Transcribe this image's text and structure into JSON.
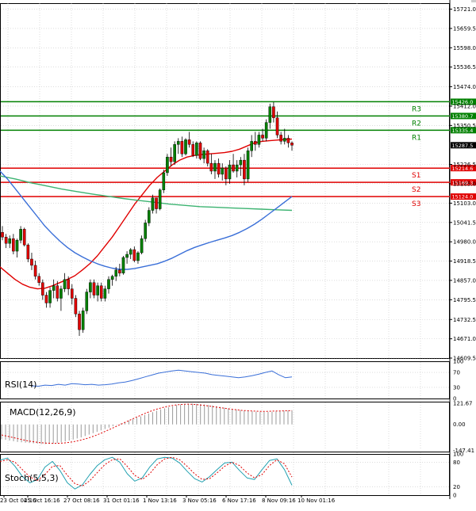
{
  "chart_data": [
    {
      "type": "candlestick",
      "panel": "price",
      "ylim": [
        14609.5,
        15740
      ],
      "y_ticks": [
        "15721.0",
        "15659.5",
        "15598.0",
        "15536.5",
        "15474.0",
        "15412.0",
        "15350.5",
        "15226.5",
        "15165.0",
        "15103.0",
        "15041.5",
        "14980.0",
        "14918.5",
        "14857.0",
        "14795.5",
        "14732.5",
        "14671.0",
        "14609.5"
      ],
      "x_ticks": [
        "23 Oct 04:16",
        "25 Oct 16:16",
        "27 Oct 08:16",
        "31 Oct 01:16",
        "1 Nov 13:16",
        "3 Nov 05:16",
        "6 Nov 17:16",
        "8 Nov 09:16",
        "10 Nov 01:16"
      ],
      "last_price": "15287.5",
      "levels": [
        {
          "name": "R3",
          "value": 15426.0,
          "label": "15426.0",
          "color": "#008000"
        },
        {
          "name": "R2",
          "value": 15380.7,
          "label": "15380.7",
          "color": "#008000"
        },
        {
          "name": "R1",
          "value": 15335.4,
          "label": "15335.4",
          "color": "#008000"
        },
        {
          "name": "S1",
          "value": 15214.6,
          "label": "15214.6",
          "color": "#e00000"
        },
        {
          "name": "S2",
          "value": 15169.3,
          "label": "15169.3",
          "color": "#e00000"
        },
        {
          "name": "S3",
          "value": 15124.0,
          "label": "15124.0",
          "color": "#e00000"
        }
      ],
      "candles": [
        [
          15010,
          15030,
          14985,
          14995
        ],
        [
          14995,
          15005,
          14960,
          14975
        ],
        [
          14975,
          15000,
          14960,
          14990
        ],
        [
          14990,
          15005,
          14940,
          14950
        ],
        [
          14950,
          14990,
          14930,
          14985
        ],
        [
          14985,
          15030,
          14975,
          15020
        ],
        [
          15020,
          15025,
          14965,
          14970
        ],
        [
          14970,
          14975,
          14915,
          14925
        ],
        [
          14925,
          14945,
          14890,
          14905
        ],
        [
          14905,
          14920,
          14860,
          14870
        ],
        [
          14870,
          14880,
          14840,
          14850
        ],
        [
          14850,
          14860,
          14795,
          14810
        ],
        [
          14810,
          14820,
          14770,
          14785
        ],
        [
          14785,
          14835,
          14770,
          14825
        ],
        [
          14825,
          14860,
          14800,
          14840
        ],
        [
          14840,
          14855,
          14790,
          14800
        ],
        [
          14800,
          14840,
          14760,
          14830
        ],
        [
          14830,
          14880,
          14820,
          14860
        ],
        [
          14860,
          14870,
          14810,
          14830
        ],
        [
          14830,
          14845,
          14780,
          14800
        ],
        [
          14800,
          14810,
          14740,
          14750
        ],
        [
          14750,
          14760,
          14680,
          14700
        ],
        [
          14700,
          14770,
          14690,
          14760
        ],
        [
          14760,
          14830,
          14750,
          14820
        ],
        [
          14820,
          14860,
          14800,
          14850
        ],
        [
          14850,
          14860,
          14800,
          14810
        ],
        [
          14810,
          14850,
          14790,
          14840
        ],
        [
          14840,
          14850,
          14790,
          14800
        ],
        [
          14800,
          14840,
          14790,
          14830
        ],
        [
          14830,
          14870,
          14815,
          14860
        ],
        [
          14860,
          14875,
          14840,
          14870
        ],
        [
          14870,
          14900,
          14855,
          14890
        ],
        [
          14890,
          14910,
          14870,
          14880
        ],
        [
          14880,
          14935,
          14875,
          14930
        ],
        [
          14930,
          14950,
          14910,
          14940
        ],
        [
          14940,
          14960,
          14925,
          14955
        ],
        [
          14955,
          14965,
          14915,
          14920
        ],
        [
          14920,
          14950,
          14910,
          14945
        ],
        [
          14945,
          15000,
          14940,
          14990
        ],
        [
          14990,
          15050,
          14980,
          15040
        ],
        [
          15040,
          15090,
          15030,
          15080
        ],
        [
          15080,
          15130,
          15070,
          15120
        ],
        [
          15120,
          15110,
          15070,
          15085
        ],
        [
          15085,
          15150,
          15080,
          15145
        ],
        [
          15145,
          15210,
          15135,
          15200
        ],
        [
          15200,
          15260,
          15190,
          15250
        ],
        [
          15250,
          15280,
          15220,
          15235
        ],
        [
          15235,
          15300,
          15225,
          15290
        ],
        [
          15290,
          15310,
          15260,
          15300
        ],
        [
          15300,
          15315,
          15250,
          15260
        ],
        [
          15260,
          15310,
          15255,
          15305
        ],
        [
          15305,
          15330,
          15280,
          15290
        ],
        [
          15290,
          15300,
          15250,
          15255
        ],
        [
          15255,
          15300,
          15245,
          15295
        ],
        [
          15295,
          15300,
          15240,
          15245
        ],
        [
          15245,
          15280,
          15230,
          15270
        ],
        [
          15270,
          15275,
          15220,
          15230
        ],
        [
          15230,
          15260,
          15195,
          15205
        ],
        [
          15205,
          15240,
          15180,
          15230
        ],
        [
          15230,
          15245,
          15185,
          15195
        ],
        [
          15195,
          15230,
          15175,
          15215
        ],
        [
          15215,
          15220,
          15160,
          15180
        ],
        [
          15180,
          15240,
          15165,
          15225
        ],
        [
          15225,
          15260,
          15200,
          15205
        ],
        [
          15205,
          15240,
          15185,
          15225
        ],
        [
          15225,
          15250,
          15190,
          15240
        ],
        [
          15240,
          15260,
          15160,
          15180
        ],
        [
          15180,
          15280,
          15170,
          15270
        ],
        [
          15270,
          15320,
          15250,
          15300
        ],
        [
          15300,
          15330,
          15270,
          15290
        ],
        [
          15290,
          15330,
          15280,
          15320
        ],
        [
          15320,
          15340,
          15300,
          15310
        ],
        [
          15310,
          15370,
          15300,
          15360
        ],
        [
          15360,
          15420,
          15340,
          15410
        ],
        [
          15410,
          15425,
          15360,
          15375
        ],
        [
          15375,
          15395,
          15310,
          15320
        ],
        [
          15320,
          15330,
          15290,
          15300
        ],
        [
          15300,
          15340,
          15290,
          15310
        ],
        [
          15310,
          15320,
          15280,
          15295
        ],
        [
          15295,
          15300,
          15270,
          15287.5
        ]
      ],
      "ma_short": [
        [
          14900,
          14880,
          14860,
          14845,
          14835,
          14830,
          14832,
          14840,
          14850,
          14860,
          14872,
          14890,
          14910,
          14935,
          14965,
          14995,
          15030,
          15065,
          15100,
          15130,
          15160,
          15185,
          15205,
          15225,
          15240,
          15250,
          15255,
          15258,
          15260,
          15262,
          15264,
          15268,
          15275,
          15285,
          15295,
          15300,
          15302,
          15304,
          15306,
          15307
        ]
      ],
      "ma_long": [
        15190,
        15180,
        15168,
        15158,
        15148,
        15140,
        15132,
        15125,
        15118,
        15112,
        15106,
        15100,
        15096,
        15092,
        15090,
        15088,
        15086,
        15084,
        15082,
        15080
      ],
      "ma_blue": [
        15205,
        15180,
        15150,
        15120,
        15090,
        15060,
        15030,
        15005,
        14982,
        14962,
        14945,
        14932,
        14920,
        14910,
        14902,
        14896,
        14892,
        14892,
        14895,
        14900,
        14905,
        14910,
        14918,
        14928,
        14940,
        14952,
        14962,
        14970,
        14978,
        14985,
        14992,
        15000,
        15010,
        15022,
        15036,
        15052,
        15070,
        15088,
        15106,
        15124
      ]
    },
    {
      "type": "line",
      "panel": "rsi",
      "title": "RSI(14)",
      "ylim": [
        0,
        100
      ],
      "y_ticks": [
        "100",
        "70",
        "30",
        "0"
      ],
      "values": [
        34,
        33,
        36,
        35,
        38,
        36,
        40,
        39,
        37,
        38,
        36,
        37,
        39,
        42,
        44,
        48,
        53,
        58,
        63,
        68,
        71,
        74,
        76,
        74,
        72,
        70,
        68,
        64,
        62,
        60,
        58,
        56,
        58,
        61,
        65,
        70,
        74,
        64,
        56,
        58
      ]
    },
    {
      "type": "bar",
      "panel": "macd",
      "title": "MACD(12,26,9)",
      "ylim": [
        -155,
        130
      ],
      "y_ticks": [
        "121.67",
        "0.00",
        "-147.41"
      ],
      "values": [
        -85,
        -88,
        -92,
        -96,
        -100,
        -102,
        -104,
        -106,
        -108,
        -110,
        -112,
        -112,
        -111,
        -109,
        -106,
        -102,
        -97,
        -92,
        -86,
        -80,
        -74,
        -66,
        -58,
        -50,
        -42,
        -34,
        -26,
        -18,
        -10,
        -2,
        6,
        14,
        22,
        30,
        38,
        46,
        54,
        62,
        70,
        78,
        86,
        92,
        98,
        104,
        110,
        114,
        117,
        119,
        119,
        118,
        116,
        114,
        111,
        108,
        104,
        100,
        96,
        92,
        88,
        85,
        82,
        79,
        77,
        75,
        73,
        72,
        71,
        71,
        72,
        74,
        76,
        78,
        79,
        80
      ],
      "signal": [
        -60,
        -68,
        -76,
        -84,
        -92,
        -98,
        -103,
        -106,
        -108,
        -108,
        -106,
        -102,
        -96,
        -88,
        -78,
        -66,
        -52,
        -36,
        -20,
        -4,
        12,
        28,
        44,
        60,
        74,
        86,
        96,
        104,
        110,
        114,
        116,
        115,
        112,
        108,
        103,
        98,
        93,
        88,
        84,
        80,
        78,
        76,
        75,
        75,
        76,
        77,
        78,
        79
      ]
    },
    {
      "type": "line",
      "panel": "stoch",
      "title": "Stoch(5,5,3)",
      "ylim": [
        0,
        100
      ],
      "y_ticks": [
        "100",
        "80",
        "20",
        "0"
      ],
      "k": [
        85,
        90,
        70,
        45,
        30,
        38,
        68,
        82,
        60,
        30,
        15,
        25,
        50,
        72,
        86,
        92,
        80,
        52,
        34,
        42,
        68,
        88,
        92,
        90,
        78,
        58,
        40,
        32,
        45,
        62,
        78,
        80,
        60,
        42,
        38,
        62,
        84,
        88,
        62,
        24
      ],
      "d": [
        82,
        86,
        80,
        62,
        44,
        36,
        50,
        70,
        72,
        48,
        28,
        22,
        35,
        55,
        74,
        86,
        88,
        70,
        48,
        38,
        52,
        74,
        88,
        92,
        86,
        70,
        52,
        38,
        40,
        54,
        70,
        80,
        72,
        54,
        42,
        50,
        72,
        86,
        76,
        44
      ]
    }
  ]
}
